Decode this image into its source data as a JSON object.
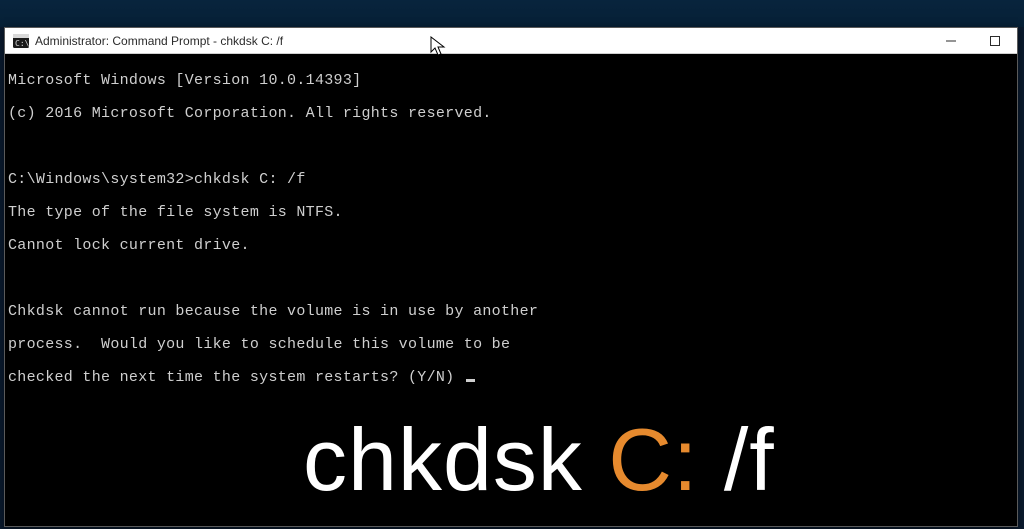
{
  "window": {
    "title": "Administrator: Command Prompt - chkdsk  C: /f"
  },
  "console": {
    "l1": "Microsoft Windows [Version 10.0.14393]",
    "l2": "(c) 2016 Microsoft Corporation. All rights reserved.",
    "l3": "C:\\Windows\\system32>chkdsk C: /f",
    "l4": "The type of the file system is NTFS.",
    "l5": "Cannot lock current drive.",
    "l6": "Chkdsk cannot run because the volume is in use by another",
    "l7": "process.  Would you like to schedule this volume to be",
    "l8": "checked the next time the system restarts? (Y/N) "
  },
  "hero": {
    "part1": "chkdsk ",
    "part2": "C:",
    "part3": " /f"
  }
}
